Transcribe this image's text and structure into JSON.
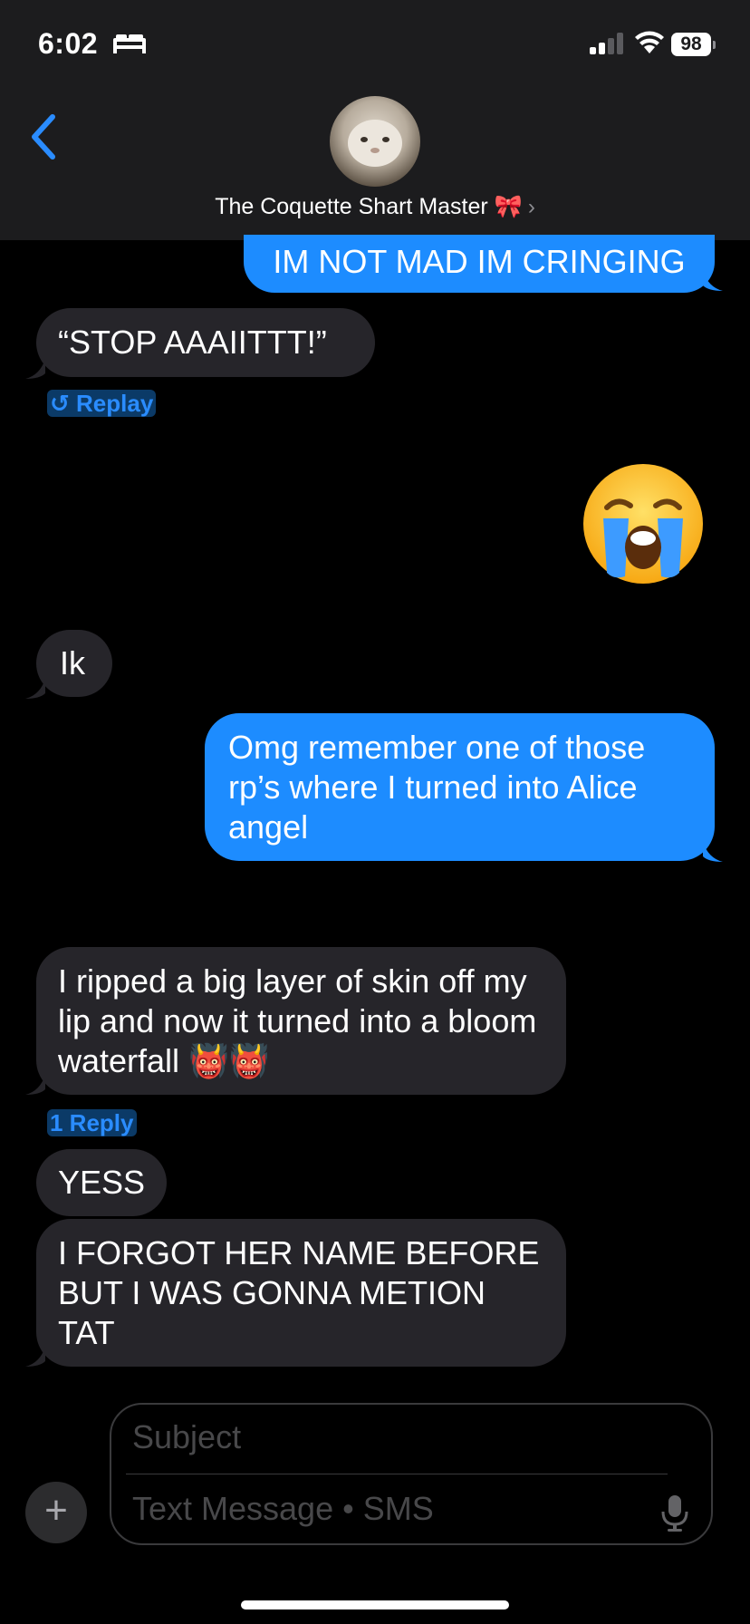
{
  "status": {
    "time": "6:02",
    "battery": "98"
  },
  "header": {
    "contact_name": "The Coquette Shart Master 🎀",
    "chevron": "›"
  },
  "messages": {
    "m1": "IM NOT MAD IM CRINGING",
    "m2": "“STOP AAAIITTT!”",
    "m2_action": "Replay",
    "m2_action_icon": "↺",
    "m3": "😭",
    "m4": "Ik",
    "m5": "Omg remember one of those rp’s where I turned into Alice angel",
    "m6": "I ripped a big layer of skin off my lip and now it turned into a bloom waterfall 👹👹",
    "m6_replies": "1 Reply",
    "m7": "YESS",
    "m8": "I FORGOT HER NAME BEFORE BUT I WAS GONNA METION TAT"
  },
  "composer": {
    "subject_placeholder": "Subject",
    "message_placeholder": "Text Message • SMS",
    "plus": "+"
  },
  "icons": [
    "bed-icon",
    "signal-icon",
    "wifi-icon",
    "battery-icon",
    "back-chevron-icon",
    "replay-icon",
    "plus-icon",
    "microphone-icon"
  ],
  "colors": {
    "sent_bubble": "#1d8cff",
    "received_bubble": "#26252a",
    "header_bg": "#1c1c1e",
    "link": "#2a8cff"
  }
}
